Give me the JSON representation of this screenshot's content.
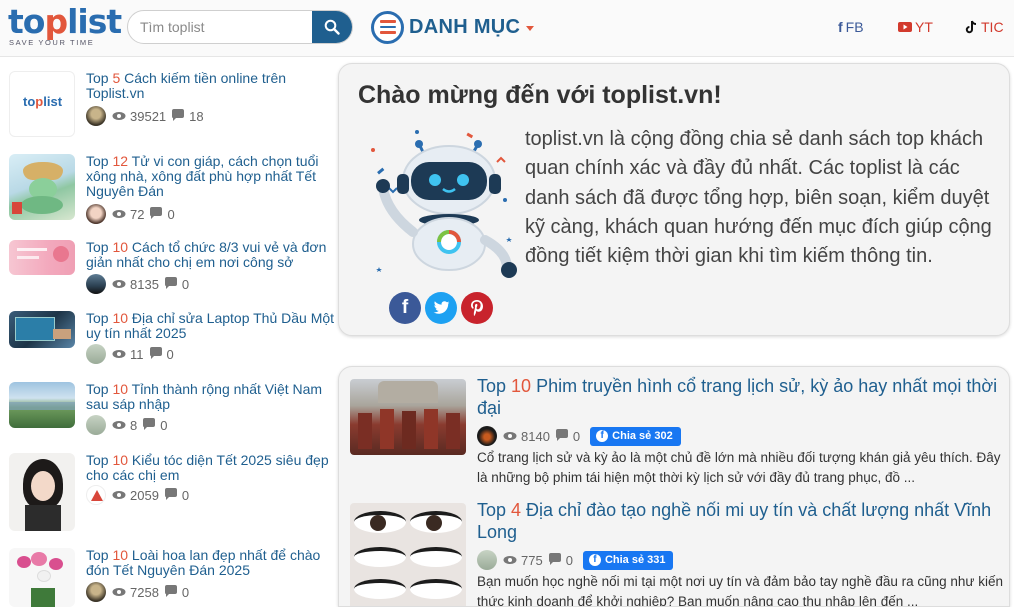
{
  "header": {
    "logo_text": "toplist",
    "logo_tagline": "SAVE YOUR TIME",
    "search_placeholder": "Tìm toplist",
    "menu_label": "DANH MỤC",
    "social": [
      {
        "label": "FB",
        "icon": "facebook-icon",
        "color": "#3b5998"
      },
      {
        "label": "YT",
        "icon": "youtube-icon",
        "color": "#d23a2d"
      },
      {
        "label": "TIC",
        "icon": "tiktok-icon",
        "color": "#d23a2d"
      }
    ]
  },
  "sidebar": {
    "items": [
      {
        "rank_prefix": "Top ",
        "rank": "5",
        "title": " Cách kiếm tiền online trên Toplist.vn",
        "views": "39521",
        "comments": "18",
        "thumb": "toplist-logo-thumb"
      },
      {
        "rank_prefix": "Top ",
        "rank": "12",
        "title": " Tử vi con giáp, cách chọn tuổi xông nhà, xông đất phù hợp nhất Tết Nguyên Đán",
        "views": "72",
        "comments": "0",
        "thumb": "snake-zodiac-thumb"
      },
      {
        "rank_prefix": "Top ",
        "rank": "10",
        "title": " Cách tổ chức 8/3 vui vẻ và đơn giản nhất cho chị em nơi công sở",
        "views": "8135",
        "comments": "0",
        "thumb": "womens-day-thumb"
      },
      {
        "rank_prefix": "Top ",
        "rank": "10",
        "title": " Địa chỉ sửa Laptop Thủ Dầu Một uy tín nhất 2025",
        "views": "11",
        "comments": "0",
        "thumb": "laptop-repair-thumb"
      },
      {
        "rank_prefix": "Top ",
        "rank": "10",
        "title": " Tỉnh thành rộng nhất Việt Nam sau sáp nhập",
        "views": "8",
        "comments": "0",
        "thumb": "landscape-thumb"
      },
      {
        "rank_prefix": "Top ",
        "rank": "10",
        "title": " Kiểu tóc diện Tết 2025 siêu đẹp cho các chị em",
        "views": "2059",
        "comments": "0",
        "thumb": "hairstyle-thumb"
      },
      {
        "rank_prefix": "Top ",
        "rank": "10",
        "title": " Loài hoa lan đẹp nhất để chào đón Tết Nguyên Đán 2025",
        "views": "7258",
        "comments": "0",
        "thumb": "orchid-thumb"
      }
    ]
  },
  "welcome": {
    "title": "Chào mừng đến với toplist.vn!",
    "text": "toplist.vn là cộng đồng chia sẻ danh sách top khách quan chính xác và đầy đủ nhất. Các toplist là các danh sách đã được tổng hợp, biên soạn, kiểm duyệt kỹ càng, khách quan hướng đến mục đích giúp cộng đồng tiết kiệm thời gian khi tìm kiếm thông tin.",
    "share": [
      {
        "glyph": "f",
        "color": "#3b5998",
        "icon": "facebook-share-icon"
      },
      {
        "glyph": "t",
        "color": "#1da1f2",
        "icon": "twitter-share-icon"
      },
      {
        "glyph": "P",
        "color": "#c8232c",
        "icon": "pinterest-share-icon"
      }
    ]
  },
  "feed": {
    "items": [
      {
        "rank_prefix": "Top ",
        "rank": "10",
        "title": " Phim truyền hình cổ trang lịch sử, kỳ ảo hay nhất mọi thời đại",
        "views": "8140",
        "comments": "0",
        "share_label": "Chia sẻ 302",
        "desc": "Cổ trang lịch sử và kỳ ảo là một chủ đề lớn mà nhiều đối tượng khán giả yêu thích. Đây là những bộ phim tái hiện một thời kỳ lịch sử với đầy đủ trang phục, đồ ...",
        "thumb": "roman-soldiers-thumb"
      },
      {
        "rank_prefix": "Top ",
        "rank": "4",
        "title": " Địa chỉ đào tạo nghề nối mi uy tín và chất lượng nhất Vĩnh Long",
        "views": "775",
        "comments": "0",
        "share_label": "Chia sẻ 331",
        "desc": "Bạn muốn học nghề nối mi tại một nơi uy tín và đảm bảo tay nghề đầu ra cũng như kiến thức kinh doanh để khởi nghiệp? Bạn muốn nâng cao thu nhập lên đến ...",
        "thumb": "eyelash-thumb"
      }
    ]
  },
  "colors": {
    "brand_blue": "#1f5f8f",
    "accent_orange": "#e2573c",
    "facebook_blue": "#1877f2"
  }
}
